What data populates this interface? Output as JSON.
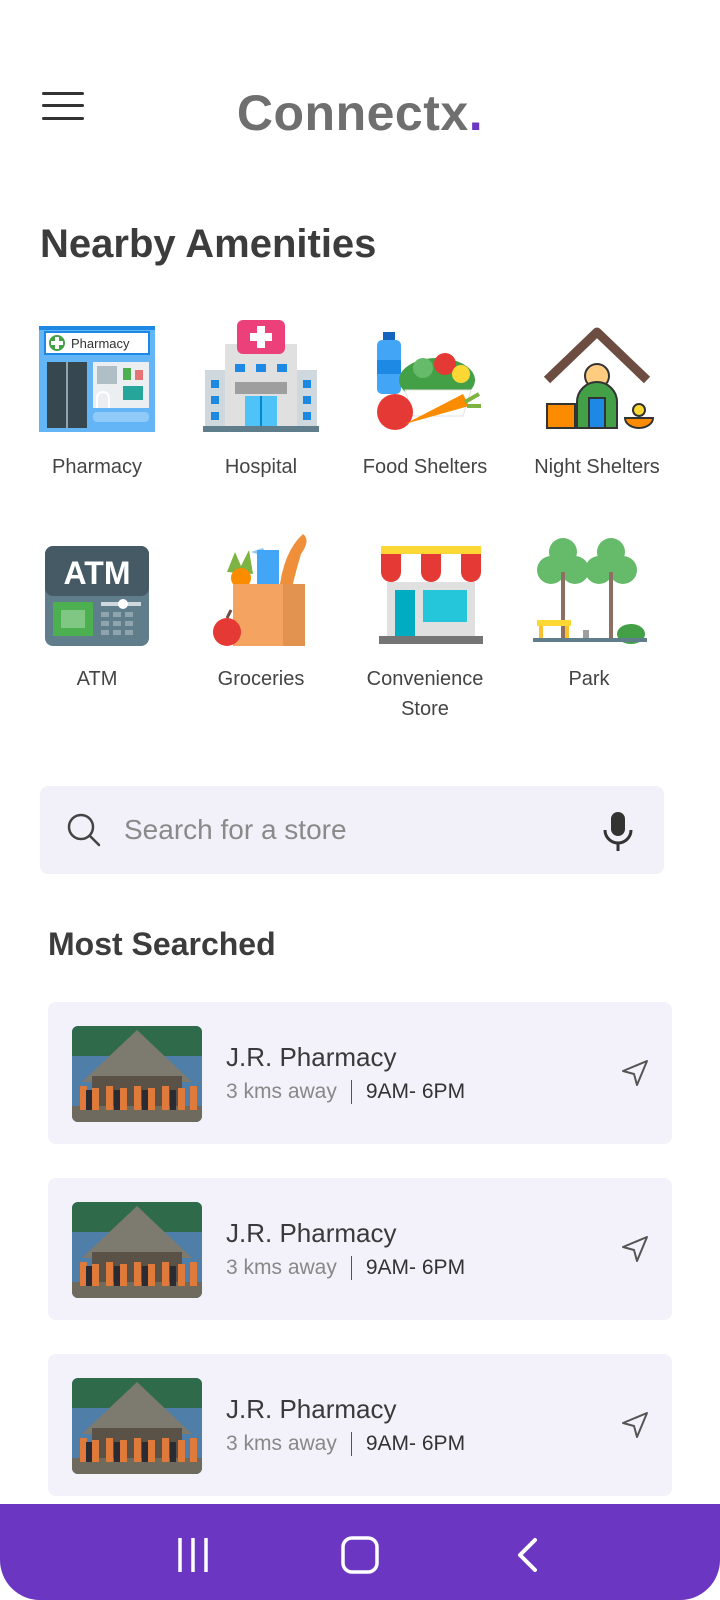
{
  "header": {
    "logo_text": "Connectx",
    "logo_dot": ".",
    "menu_icon": "hamburger-icon"
  },
  "nearby": {
    "title": "Nearby Amenities",
    "items": [
      {
        "label": "Pharmacy",
        "icon": "pharmacy-icon",
        "sign": "Pharmacy"
      },
      {
        "label": "Hospital",
        "icon": "hospital-icon"
      },
      {
        "label": "Food Shelters",
        "icon": "food-shelter-icon"
      },
      {
        "label": "Night Shelters",
        "icon": "night-shelter-icon"
      },
      {
        "label": "ATM",
        "icon": "atm-icon",
        "sign": "ATM"
      },
      {
        "label": "Groceries",
        "icon": "groceries-icon"
      },
      {
        "label": "Convenience Store",
        "label_line1": "Convenience",
        "label_line2": "Store",
        "icon": "convenience-store-icon"
      },
      {
        "label": "Park",
        "icon": "park-icon"
      }
    ]
  },
  "search": {
    "placeholder": "Search for a store",
    "icon": "search-icon",
    "mic_icon": "microphone-icon"
  },
  "most_searched": {
    "title": "Most Searched",
    "items": [
      {
        "name": "J.R. Pharmacy",
        "distance": "3 kms away",
        "hours": "9AM- 6PM"
      },
      {
        "name": "J.R. Pharmacy",
        "distance": "3 kms away",
        "hours": "9AM- 6PM"
      },
      {
        "name": "J.R. Pharmacy",
        "distance": "3 kms away",
        "hours": "9AM- 6PM"
      }
    ]
  },
  "colors": {
    "accent": "#6b36c2",
    "card_bg": "#f3f2fa",
    "search_bg": "#f2f1f9"
  },
  "system_nav": {
    "icons": [
      "recent-apps-icon",
      "home-icon",
      "back-icon"
    ]
  }
}
